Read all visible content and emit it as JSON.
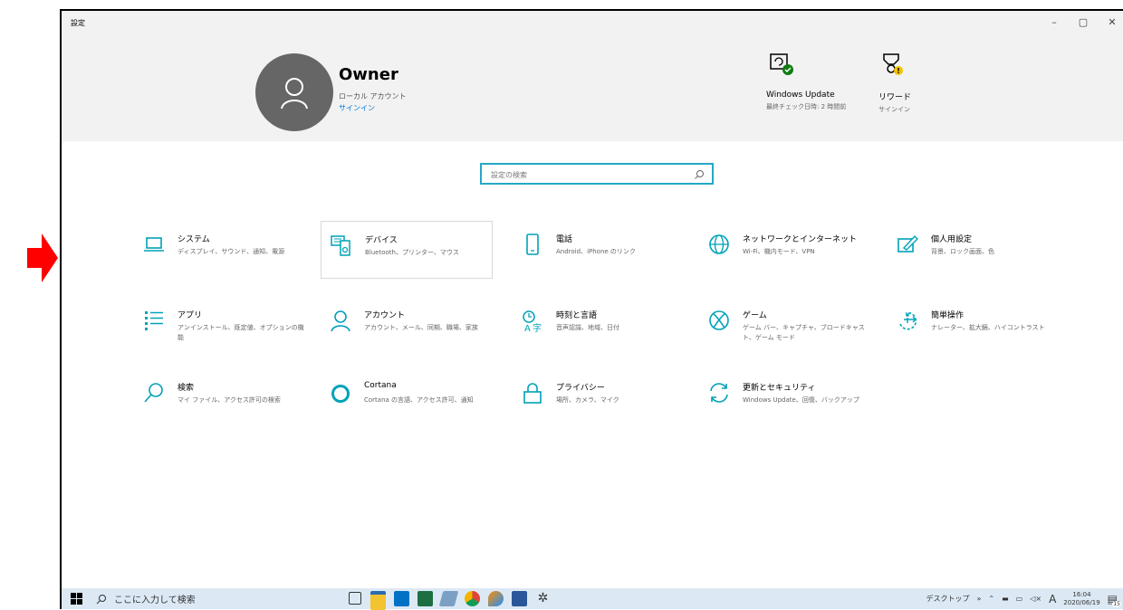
{
  "window": {
    "title": "設定",
    "controls": [
      "–",
      "▢",
      "✕"
    ]
  },
  "profile": {
    "name": "Owner",
    "account_type": "ローカル アカウント",
    "signin_link": "サインイン"
  },
  "header_items": [
    {
      "title": "Windows Update",
      "sub": "最終チェック日時: 2 時間前",
      "icon": "windows-update-icon"
    },
    {
      "title": "リワード",
      "sub": "サインイン",
      "icon": "rewards-icon"
    }
  ],
  "search": {
    "placeholder": "設定の検索"
  },
  "categories": [
    {
      "title": "システム",
      "desc": "ディスプレイ、サウンド、通知、電源",
      "icon": "laptop-icon"
    },
    {
      "title": "デバイス",
      "desc": "Bluetooth、プリンター、マウス",
      "icon": "devices-icon"
    },
    {
      "title": "電話",
      "desc": "Android、iPhone のリンク",
      "icon": "phone-icon"
    },
    {
      "title": "ネットワークとインターネット",
      "desc": "Wi-Fi、機内モード、VPN",
      "icon": "globe-icon"
    },
    {
      "title": "個人用設定",
      "desc": "背景、ロック画面、色",
      "icon": "personalization-icon"
    },
    {
      "title": "アプリ",
      "desc": "アンインストール、既定値、オプションの機能",
      "icon": "apps-icon"
    },
    {
      "title": "アカウント",
      "desc": "アカウント、メール、同期、職場、家族",
      "icon": "person-icon"
    },
    {
      "title": "時刻と言語",
      "desc": "音声認識、地域、日付",
      "icon": "time-language-icon"
    },
    {
      "title": "ゲーム",
      "desc": "ゲーム バー、キャプチャ、ブロードキャスト、ゲーム モード",
      "icon": "xbox-icon"
    },
    {
      "title": "簡単操作",
      "desc": "ナレーター、拡大鏡、ハイコントラスト",
      "icon": "ease-of-access-icon"
    },
    {
      "title": "検索",
      "desc": "マイ ファイル、アクセス許可の検索",
      "icon": "search-icon"
    },
    {
      "title": "Cortana",
      "desc": "Cortana の言語、アクセス許可、通知",
      "icon": "cortana-icon"
    },
    {
      "title": "プライバシー",
      "desc": "場所、カメラ、マイク",
      "icon": "lock-icon"
    },
    {
      "title": "更新とセキュリティ",
      "desc": "Windows Update、回復、バックアップ",
      "icon": "update-icon"
    }
  ],
  "taskbar": {
    "search_placeholder": "ここに入力して検索",
    "desktop_label": "デスクトップ",
    "chevron": "»",
    "ime": "A",
    "time": "16:04",
    "date": "2020/06/19",
    "notification_count": "15"
  },
  "colors": {
    "accent": "#0078d7",
    "icon_teal": "#00a2b8",
    "arrow": "#ff0000"
  }
}
